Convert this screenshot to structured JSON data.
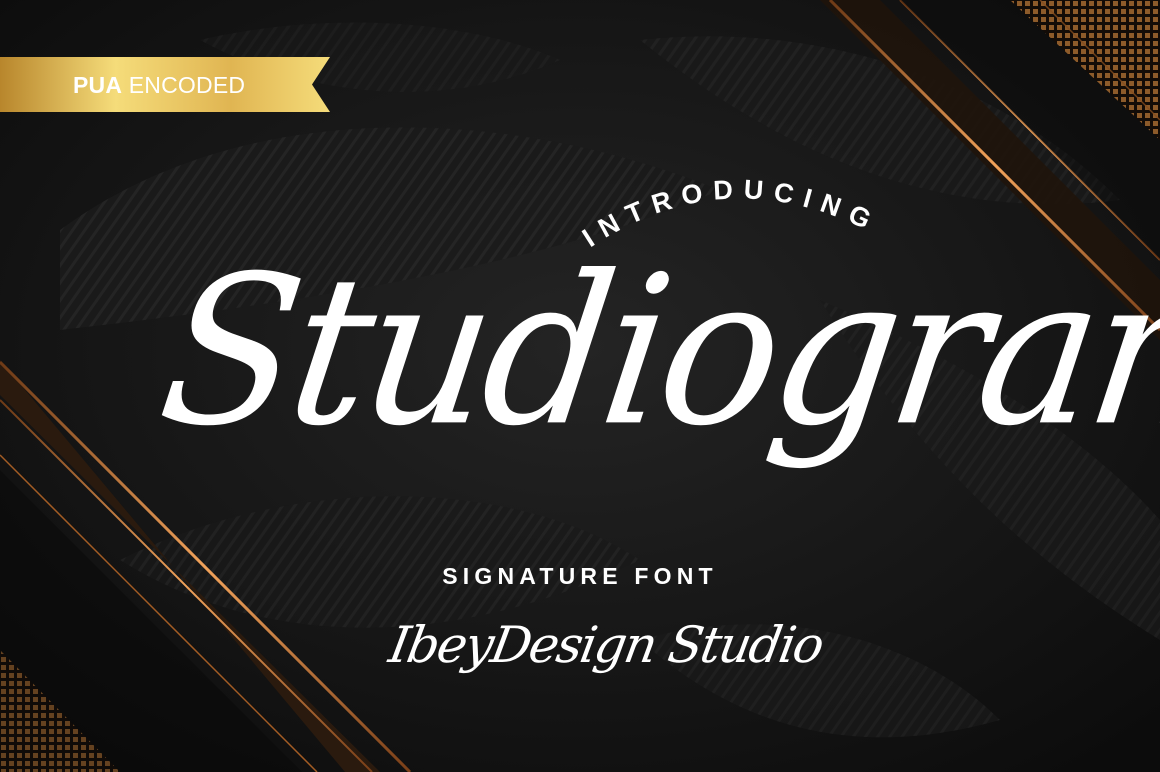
{
  "ribbon": {
    "bold": "PUA",
    "light": "ENCODED",
    "colors": {
      "gold_light": "#f5dc7a",
      "gold_dark": "#b8862c"
    }
  },
  "intro": "INTRODUCING",
  "title": "Studiogrand",
  "subtitle": "SIGNATURE FONT",
  "studio": "IbeyDesign Studio",
  "colors": {
    "background": "#121212",
    "copper": "#c8702a",
    "copper_highlight": "#f1a25a",
    "text": "#ffffff"
  }
}
